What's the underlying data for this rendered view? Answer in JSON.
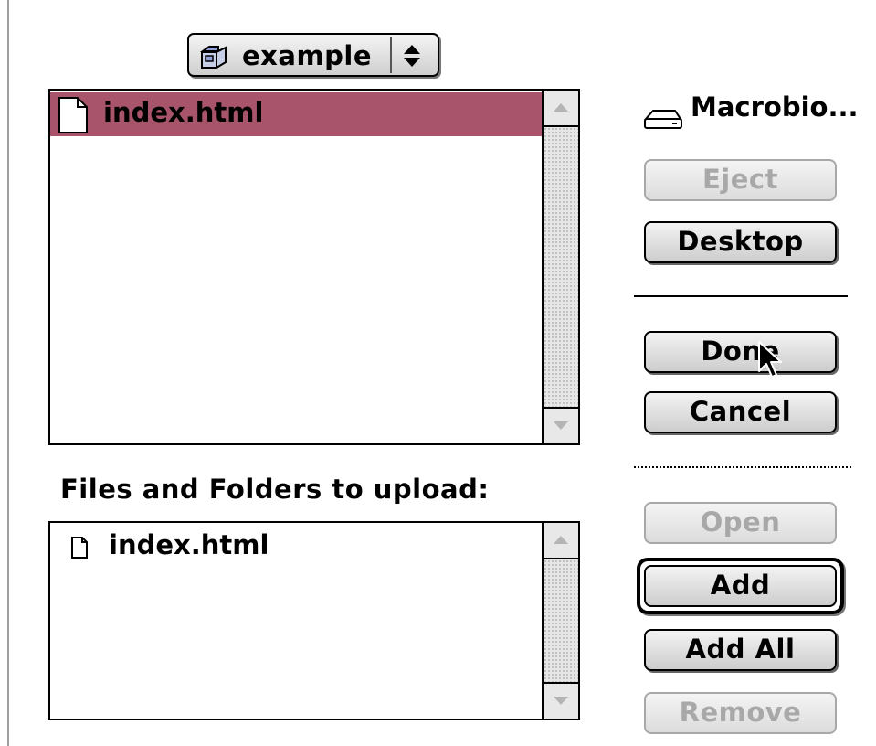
{
  "folder_popup": {
    "label": "example",
    "icon": "folder-icon"
  },
  "browser_list": {
    "items": [
      {
        "name": "index.html",
        "icon": "document-icon",
        "selected": true
      }
    ]
  },
  "upload_section": {
    "label": "Files and Folders to upload:",
    "items": [
      {
        "name": "index.html",
        "icon": "document-icon"
      }
    ]
  },
  "volume": {
    "name": "Macrobio...",
    "icon": "disk-icon"
  },
  "buttons": {
    "eject": "Eject",
    "desktop": "Desktop",
    "done": "Done",
    "cancel": "Cancel",
    "open": "Open",
    "add": "Add",
    "add_all": "Add All",
    "remove": "Remove"
  },
  "colors": {
    "selection": "#a8546a",
    "disabled_text": "#a8a8a8"
  }
}
